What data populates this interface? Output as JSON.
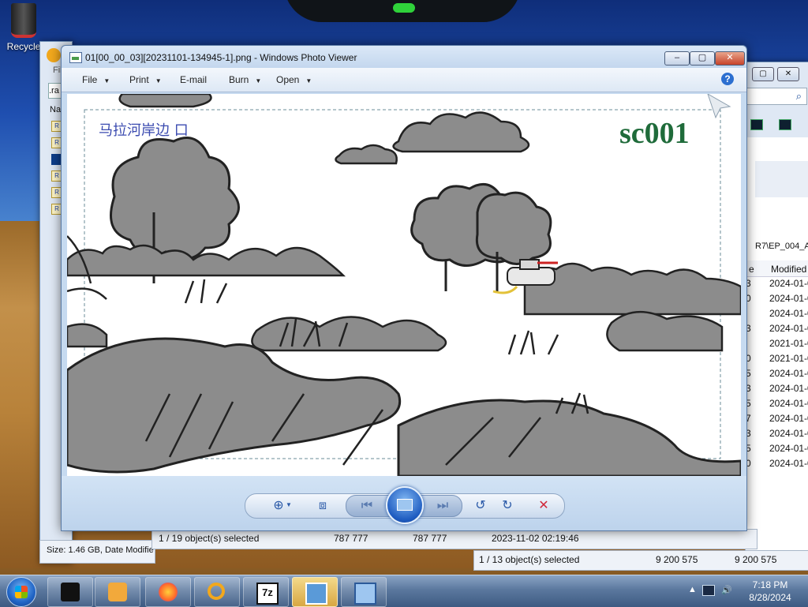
{
  "desktop": {
    "recycle_label": "Recycle"
  },
  "explorer_back": {
    "menu_fragment": "Fil",
    "search_fragment": ".ra",
    "name_header_fragment": "Na",
    "file_icon_letter": "R",
    "path_fragment": "R7\\EP_004_A",
    "modified_header": "Modified",
    "size_info": "Size: 1.46 GB, Date Modifie",
    "dates": [
      "2024-01-0",
      "2024-01-0",
      "2024-01-0",
      "2024-01-0",
      "2021-01-0",
      "2021-01-0",
      "2024-01-0",
      "2024-01-0",
      "2024-01-0",
      "2024-01-0",
      "2024-01-0",
      "2024-01-0",
      "2024-01-0"
    ],
    "row_digits": [
      "3",
      "0",
      "",
      "3",
      "",
      "0",
      "5",
      "3",
      "5",
      "7",
      "3",
      "5",
      "0"
    ]
  },
  "status_bar_1": {
    "selected": "1 / 19 object(s) selected",
    "size_a": "787 777",
    "size_b": "787 777",
    "date": "2023-11-02 02:19:46"
  },
  "status_bar_2": {
    "selected": "1 / 13 object(s) selected",
    "size_a": "9 200 575",
    "size_b": "9 200 575"
  },
  "photo_viewer": {
    "title": "01[00_00_03][20231101-134945-1].png - Windows Photo Viewer",
    "menu": {
      "file": "File",
      "print": "Print",
      "email": "E-mail",
      "burn": "Burn",
      "open": "Open"
    },
    "image": {
      "caption_cn": "马拉河岸边 口",
      "scene_code": "sc001"
    },
    "controls": {
      "zoom_icon": "magnifier-icon",
      "fit_icon": "fit-window-icon",
      "prev_icon": "previous-icon",
      "slideshow_icon": "slideshow-icon",
      "next_icon": "next-icon",
      "rotate_ccw_icon": "rotate-counterclockwise-icon",
      "rotate_cw_icon": "rotate-clockwise-icon",
      "delete_icon": "delete-icon"
    }
  },
  "taskbar": {
    "clock_time": "7:18 PM",
    "clock_date": "8/28/2024",
    "apps": [
      "Windows",
      "Terminal",
      "Media Player",
      "Firefox",
      "Search",
      "7z",
      "Notepad",
      "Photo Viewer"
    ]
  },
  "colors": {
    "scene_code_green": "#1f6b3a",
    "caption_blue": "#3b4bb0",
    "sketch_gray": "#8c8c8c",
    "delete_red": "#d0283a"
  }
}
